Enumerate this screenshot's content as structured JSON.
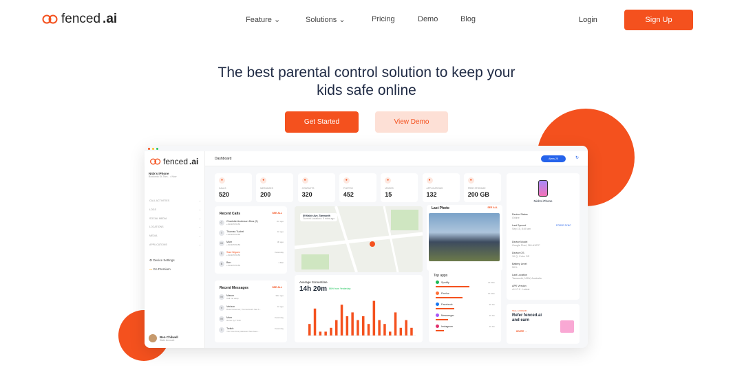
{
  "nav": {
    "logo_text": "fenced",
    "logo_bold": ".ai",
    "links": [
      "Feature",
      "Solutions",
      "Pricing",
      "Demo",
      "Blog"
    ],
    "login": "Login",
    "signup": "Sign Up"
  },
  "hero": {
    "line1": "The best parental control solution to keep your",
    "line2": "kids safe online",
    "get_started": "Get Started",
    "view_demo": "View Demo"
  },
  "colors": {
    "accent": "#f4511e"
  },
  "dashboard": {
    "logo_text": "fenced",
    "logo_bold": ".ai",
    "title": "Dashboard",
    "alerts": "Alerts 25",
    "device_name": "Nick's iPhone",
    "device_loc": "Bookonia St, Tam... • Now",
    "menu": [
      "CALL ACTIVITIES",
      "LOGS",
      "SOCIAL MEDIA",
      "LOCATIONS",
      "MEDIA",
      "APPLICATIONS"
    ],
    "device_settings": "Device Settings",
    "go_premium": "Go Premium",
    "user_name": "Ben Chilwell",
    "user_role": "Slate Account",
    "stats": [
      {
        "label": "CALLS",
        "value": "520"
      },
      {
        "label": "MESSAGES",
        "value": "200"
      },
      {
        "label": "CONTACTS",
        "value": "320"
      },
      {
        "label": "PHOTOS",
        "value": "452"
      },
      {
        "label": "VIDEOS",
        "value": "15"
      },
      {
        "label": "APPLICATIONS",
        "value": "132"
      },
      {
        "label": "FREE STORAGE",
        "value": "200 GB"
      }
    ],
    "recent_calls": {
      "title": "Recent Calls",
      "see_all": "SEE ALL",
      "items": [
        {
          "name": "Charlotte Anderson Dina (2)",
          "num": "+61491570156",
          "time": "2m ago"
        },
        {
          "name": "Thomas Tuchel",
          "num": "+61491570156",
          "time": "1h ago"
        },
        {
          "name": "Mum",
          "num": "+61491570156",
          "time": "3h ago"
        },
        {
          "name": "Saul Niguez",
          "num": "+61491570156",
          "time": "Yesterday"
        },
        {
          "name": "Ben",
          "num": "+61491570156",
          "time": "1 Mar"
        }
      ]
    },
    "recent_messages": {
      "title": "Recent Messages",
      "see_all": "SEE ALL",
      "items": [
        {
          "name": "Mason",
          "text": "Call me asap",
          "time": "30m ago"
        },
        {
          "name": "Verizon",
          "text": "Dear Customer, Your account has b...",
          "time": "1h ago"
        },
        {
          "name": "Mum",
          "text": "Home by 7 tbch",
          "time": "Yesterday"
        },
        {
          "name": "Twitch",
          "text": "Your one time password has been...",
          "time": "Yesterday"
        }
      ]
    },
    "map_label": "89 Kable Ave, Tamworth",
    "map_sub": "Current Location • 5 mins ago",
    "screentime": {
      "title": "Average Screentime",
      "value": "14h 20m",
      "delta": "86% from Yesterday"
    },
    "last_photo": {
      "title": "Last Photo",
      "see_all": "SEE ALL"
    },
    "top_apps": {
      "title": "Top apps",
      "items": [
        {
          "name": "Spotify",
          "time": "4h 30m",
          "color": "#1db954",
          "pct": 0.82
        },
        {
          "name": "Firefox",
          "time": "3h 30m",
          "color": "#ff7139",
          "pct": 0.65
        },
        {
          "name": "Facebook",
          "time": "2h 0m",
          "color": "#1877f2",
          "pct": 0.45
        },
        {
          "name": "Messenger",
          "time": "1h 0m",
          "color": "#a855f7",
          "pct": 0.3
        },
        {
          "name": "Instagram",
          "time": "1h 0m",
          "color": "#e1306c",
          "pct": 0.2
        }
      ]
    },
    "device_panel": {
      "name": "Nick's iPhone",
      "status_label": "Device Status",
      "status": "Online",
      "synced_label": "Last Synced",
      "synced": "Sep 15, 8:40 am",
      "force_sync": "FORCE SYNC",
      "model_label": "Device Model",
      "model": "Google Pixel, SM-A107F",
      "os_label": "Device OS",
      "os": "10 Q, Color OS",
      "battery_label": "Battery Level",
      "battery": "50%",
      "location_label": "Last Location",
      "location": "Tamworth, NSW, Australia",
      "apk_label": "APK Version",
      "apk": "v1.17.0 · Latest"
    },
    "refer": {
      "tag": "TELL A FRIEND",
      "line1": "Refer fenced.ai",
      "line2": "and earn",
      "invite": "INVITE →"
    }
  },
  "chart_data": {
    "type": "bar",
    "title": "Average Screentime",
    "series": [
      {
        "values": [
          3,
          7,
          1,
          1,
          2,
          4,
          8,
          5,
          6,
          4,
          5,
          3,
          9,
          4,
          3,
          1,
          6,
          2,
          4,
          2
        ]
      }
    ]
  }
}
